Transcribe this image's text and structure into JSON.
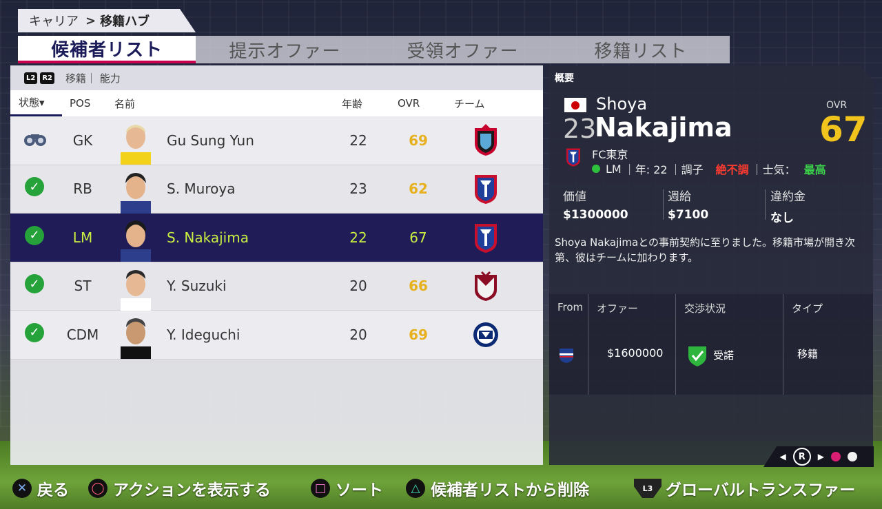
{
  "breadcrumb": {
    "root": "キャリア",
    "separator": ">",
    "current": "移籍ハブ"
  },
  "tabs": [
    {
      "label": "候補者リスト",
      "active": true
    },
    {
      "label": "提示オファー",
      "active": false
    },
    {
      "label": "受領オファー",
      "active": false
    },
    {
      "label": "移籍リスト",
      "active": false
    }
  ],
  "list": {
    "toolbar": {
      "l2": "L2",
      "r2": "R2",
      "filter": "移籍｜ 能力"
    },
    "headers": {
      "status": "状態▾",
      "pos": "POS",
      "name": "名前",
      "age": "年齢",
      "ovr": "OVR",
      "team": "チーム"
    },
    "rows": [
      {
        "status": "scouting",
        "pos": "GK",
        "name": "Gu Sung Yun",
        "age": "22",
        "ovr": "69",
        "team_icon": "sapporo-crest"
      },
      {
        "status": "done",
        "pos": "RB",
        "name": "S. Muroya",
        "age": "23",
        "ovr": "62",
        "team_icon": "fc-tokyo-crest"
      },
      {
        "status": "done",
        "pos": "LM",
        "name": "S. Nakajima",
        "age": "22",
        "ovr": "67",
        "team_icon": "fc-tokyo-crest"
      },
      {
        "status": "done",
        "pos": "ST",
        "name": "Y. Suzuki",
        "age": "20",
        "ovr": "66",
        "team_icon": "kashima-crest"
      },
      {
        "status": "done",
        "pos": "CDM",
        "name": "Y. Ideguchi",
        "age": "20",
        "ovr": "69",
        "team_icon": "gamba-crest"
      }
    ]
  },
  "detail": {
    "title": "概要",
    "first_name": "Shoya",
    "number": "23",
    "last_name": "Nakajima",
    "ovr_label": "OVR",
    "ovr": "67",
    "club": "FC東京",
    "position": "LM",
    "age_label": "｜年: 22",
    "form_label": "｜調子",
    "form_value": "絶不調",
    "morale_label": "｜士気：",
    "morale_value": "最高",
    "stats": [
      {
        "label": "価値",
        "value": "$1300000"
      },
      {
        "label": "週給",
        "value": "$7100"
      },
      {
        "label": "違約金",
        "value": "なし"
      }
    ],
    "description": "Shoya Nakajimaとの事前契約に至りました。移籍市場が開き次第、彼はチームに加わります。",
    "offer": {
      "headers": {
        "from": "From",
        "offer": "オファー",
        "status": "交渉状況",
        "type": "タイプ"
      },
      "from_icon": "yokohama-crest",
      "amount": "$1600000",
      "status": "受諾",
      "type": "移籍"
    },
    "pager": {
      "button": "R"
    }
  },
  "hints": [
    {
      "button": "cross",
      "label": "戻る"
    },
    {
      "button": "circle",
      "label": "アクションを表示する"
    },
    {
      "button": "square",
      "label": "ソート"
    },
    {
      "button": "triangle",
      "label": "候補者リストから削除"
    },
    {
      "button": "l3",
      "l3": "L3",
      "label": "グローバルトランスファー"
    }
  ],
  "colors": {
    "accent": "#1f1c58",
    "highlight": "#c9f040",
    "ovr": "#e6b01e",
    "tab_underline": "#c8004d"
  }
}
